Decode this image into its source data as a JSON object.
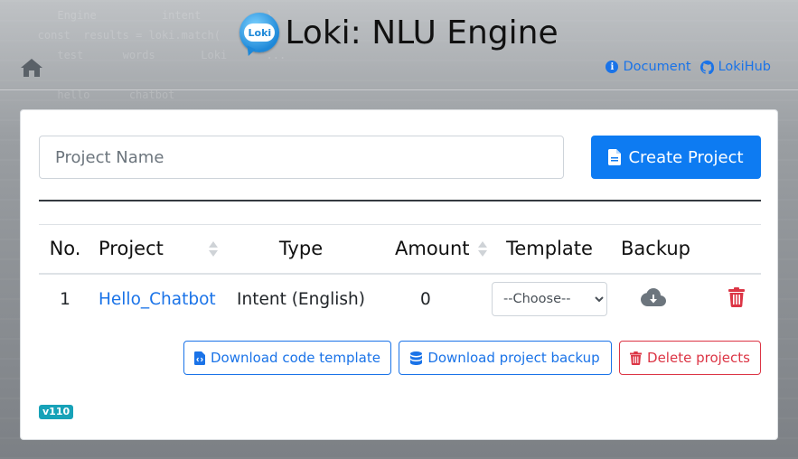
{
  "app": {
    "title": "Loki: NLU Engine",
    "logo_text": "Loki"
  },
  "header": {
    "links": [
      {
        "label": "Document",
        "icon": "info-circle-icon"
      },
      {
        "label": "LokiHub",
        "icon": "github-icon"
      }
    ]
  },
  "form": {
    "project_name_placeholder": "Project Name",
    "project_name_value": "",
    "create_label": "Create Project"
  },
  "table": {
    "headers": [
      "No.",
      "Project",
      "Type",
      "Amount",
      "Template",
      "Backup"
    ],
    "rows": [
      {
        "no": "1",
        "project": "Hello_Chatbot",
        "type": "Intent (English)",
        "amount": "0",
        "template": "--Choose--"
      }
    ]
  },
  "actions": {
    "download_template": "Download code template",
    "download_backup": "Download project backup",
    "delete_projects": "Delete projects"
  },
  "version": "v110",
  "colors": {
    "primary": "#0d7bf2",
    "link": "#1a73e8",
    "danger": "#dc3545",
    "badge": "#17a2b8"
  }
}
